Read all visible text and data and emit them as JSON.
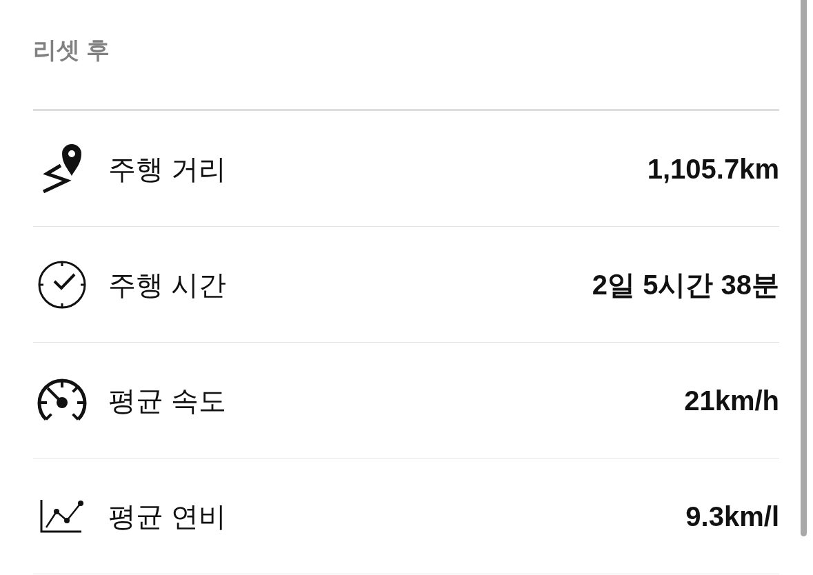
{
  "section": {
    "title": "리셋 후"
  },
  "stats": [
    {
      "kind": "distance",
      "label": "주행 거리",
      "value": "1,105.7km"
    },
    {
      "kind": "time",
      "label": "주행 시간",
      "value": "2일 5시간 38분"
    },
    {
      "kind": "speed",
      "label": "평균 속도",
      "value": "21km/h"
    },
    {
      "kind": "economy",
      "label": "평균 연비",
      "value": "9.3km/l"
    }
  ]
}
